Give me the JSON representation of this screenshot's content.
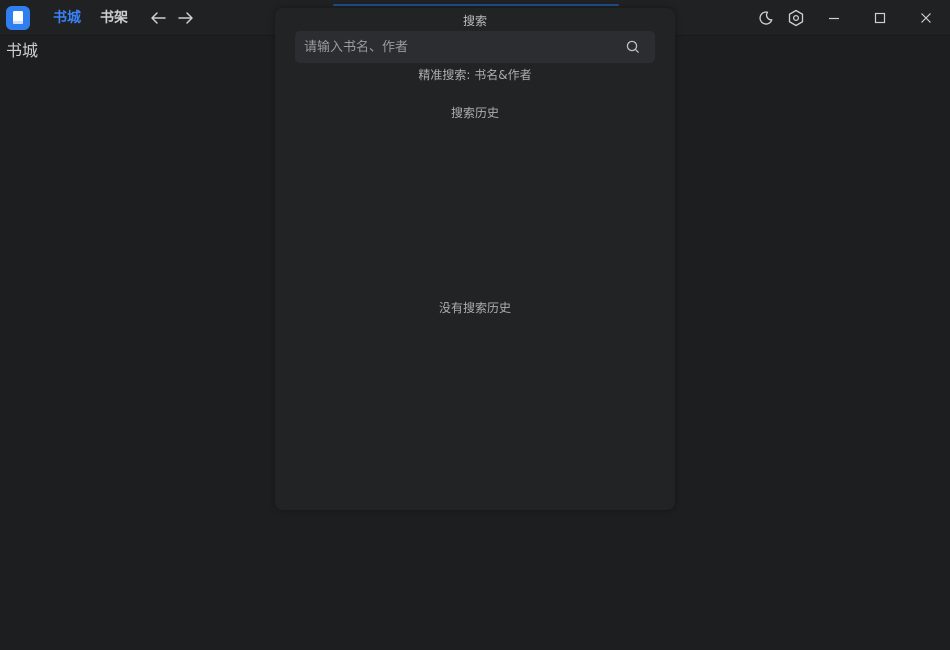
{
  "header": {
    "tabs": [
      {
        "label": "书城",
        "active": true
      },
      {
        "label": "书架",
        "active": false
      }
    ],
    "icons": {
      "logo": "book-icon",
      "back": "arrow-left-icon",
      "forward": "arrow-right-icon",
      "theme": "moon-icon",
      "settings": "gear-icon",
      "minimize": "minimize-icon",
      "maximize": "maximize-icon",
      "close": "close-icon"
    }
  },
  "page": {
    "heading": "书城"
  },
  "search_panel": {
    "title": "搜索",
    "placeholder": "请输入书名、作者",
    "precise_hint": "精准搜索: 书名&作者",
    "history_title": "搜索历史",
    "history_empty": "没有搜索历史"
  },
  "colors": {
    "accent": "#3b82f6",
    "background": "#1c1e20",
    "panel": "#212325"
  }
}
